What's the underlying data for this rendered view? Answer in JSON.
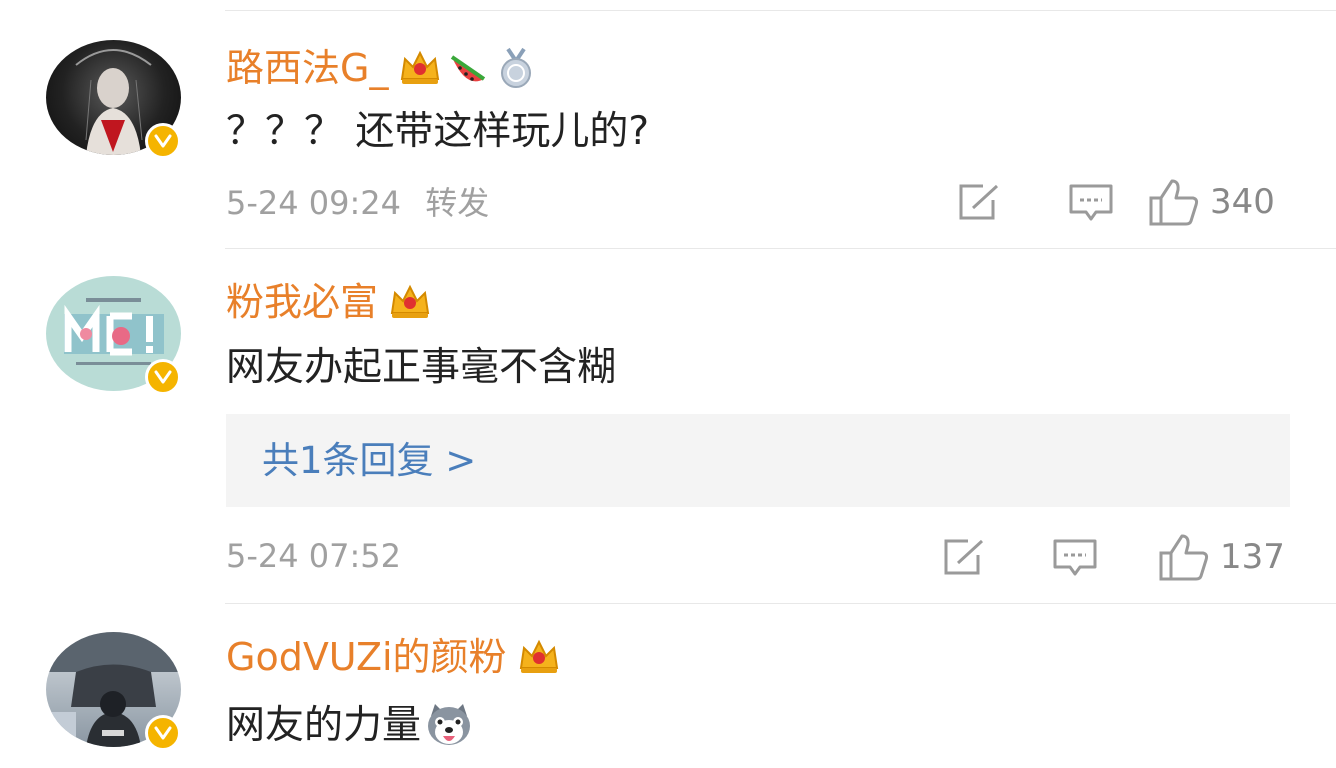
{
  "comments": [
    {
      "username": "路西法G_",
      "text": "？？？ 还带这样玩儿的?",
      "time": "5-24 09:24",
      "repost_label": "转发",
      "likes": "340",
      "badges": [
        "crown-badge-icon",
        "watermelon-badge-icon",
        "medal-badge-icon"
      ]
    },
    {
      "username": "粉我必富",
      "text": "网友办起正事毫不含糊",
      "replies_label": "共1条回复 >",
      "time": "5-24 07:52",
      "likes": "137",
      "badges": [
        "crown-badge-icon"
      ]
    },
    {
      "username": "GodVUZi的颜粉",
      "text": "网友的力量",
      "emoji": "husky-emoji-icon",
      "badges": [
        "crown-badge-icon"
      ]
    }
  ],
  "colors": {
    "username": "#e8802a",
    "reply_link": "#4a7ebb",
    "verified_badge": "#f5b400",
    "meta_text": "#a0a0a0"
  }
}
